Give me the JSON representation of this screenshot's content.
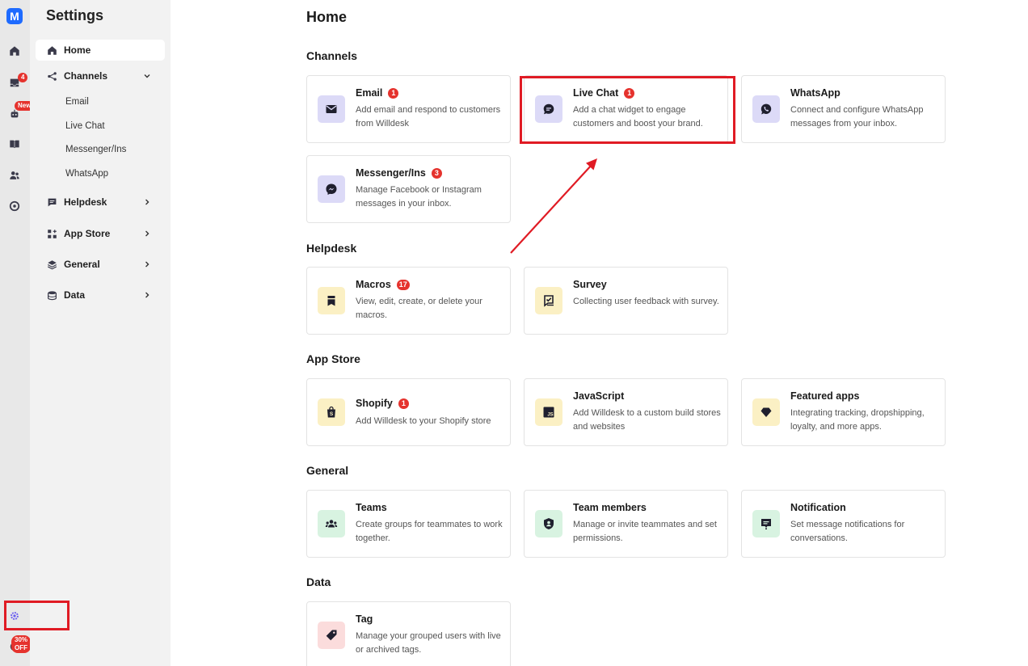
{
  "app": {
    "logo_letter": "M"
  },
  "rail": {
    "inbox_badge": "4",
    "bot_badge": "New",
    "promo_badge": "30% OFF"
  },
  "sidebar": {
    "title": "Settings",
    "items": [
      {
        "label": "Home",
        "icon": "home-icon"
      },
      {
        "label": "Channels",
        "icon": "share-icon"
      },
      {
        "label": "Helpdesk",
        "icon": "chat-icon"
      },
      {
        "label": "App Store",
        "icon": "apps-icon"
      },
      {
        "label": "General",
        "icon": "layers-icon"
      },
      {
        "label": "Data",
        "icon": "database-icon"
      }
    ],
    "channels_sub": [
      "Email",
      "Live Chat",
      "Messenger/Ins",
      "WhatsApp"
    ]
  },
  "main": {
    "title": "Home",
    "sections": {
      "channels": "Channels",
      "helpdesk": "Helpdesk",
      "app_store": "App Store",
      "general": "General",
      "data": "Data"
    },
    "cards": {
      "email": {
        "title": "Email",
        "badge": "1",
        "desc": "Add email and respond to customers from Willdesk"
      },
      "live_chat": {
        "title": "Live Chat",
        "badge": "1",
        "desc": "Add a chat widget to engage customers and boost your brand."
      },
      "whatsapp": {
        "title": "WhatsApp",
        "desc": "Connect and configure WhatsApp messages from your inbox."
      },
      "messenger": {
        "title": "Messenger/Ins",
        "badge": "3",
        "desc": "Manage Facebook or Instagram messages in your inbox."
      },
      "macros": {
        "title": "Macros",
        "badge": "17",
        "desc": "View, edit, create, or delete your macros."
      },
      "survey": {
        "title": "Survey",
        "desc": "Collecting user feedback with survey."
      },
      "shopify": {
        "title": "Shopify",
        "badge": "1",
        "desc": "Add Willdesk to your Shopify store"
      },
      "javascript": {
        "title": "JavaScript",
        "desc": "Add Willdesk to a custom build stores and websites",
        "icon_text": "JS"
      },
      "featured_apps": {
        "title": "Featured apps",
        "desc": "Integrating tracking, dropshipping, loyalty, and more apps."
      },
      "teams": {
        "title": "Teams",
        "desc": "Create groups for teammates to work together."
      },
      "team_members": {
        "title": "Team members",
        "desc": "Manage or invite teammates and set permissions."
      },
      "notification": {
        "title": "Notification",
        "desc": "Set message notifications for conversations."
      },
      "tag": {
        "title": "Tag",
        "desc": "Manage your grouped users with live or archived tags."
      }
    }
  },
  "colors": {
    "accent_blue": "#1e6bff",
    "badge_red": "#e5322d",
    "annotation_red": "#e01b24",
    "icon_purple_bg": "#dcdaf7",
    "icon_yellow_bg": "#fbf0c4",
    "icon_green_bg": "#d8f3e1",
    "icon_pink_bg": "#fbdcdc"
  }
}
